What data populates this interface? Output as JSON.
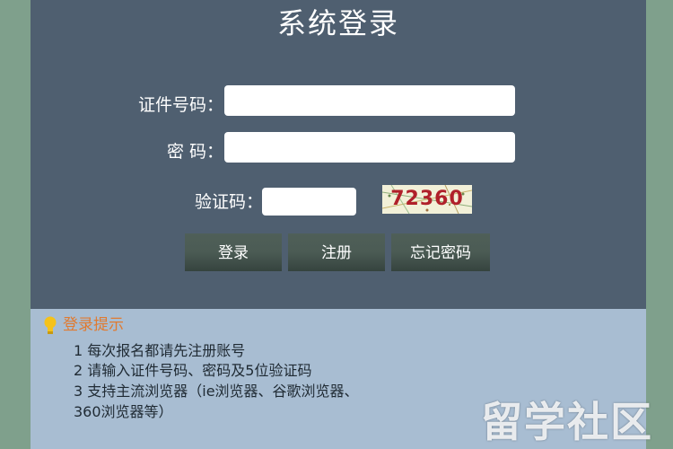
{
  "login": {
    "title": "系统登录",
    "id_label": "证件号码：",
    "id_value": "",
    "password_label": "密 码：",
    "password_value": "",
    "captcha_label": "验证码：",
    "captcha_value": "",
    "captcha_code": "72360"
  },
  "buttons": {
    "login": "登录",
    "register": "注册",
    "forgot": "忘记密码"
  },
  "tips": {
    "title": "登录提示",
    "lines": [
      "1 每次报名都请先注册账号",
      "2 请输入证件号码、密码及5位验证码",
      "3 支持主流浏览器（ie浏览器、谷歌浏览器、",
      "360浏览器等）"
    ]
  },
  "watermark": "留学社区",
  "colors": {
    "page_background": "#7fa08c",
    "panel_background": "#4f5f70",
    "tips_background": "#a8bdd2",
    "tips_title": "#e07a30",
    "captcha_text": "#b0202a"
  },
  "icons": {
    "tips_icon": "lightbulb-icon"
  }
}
